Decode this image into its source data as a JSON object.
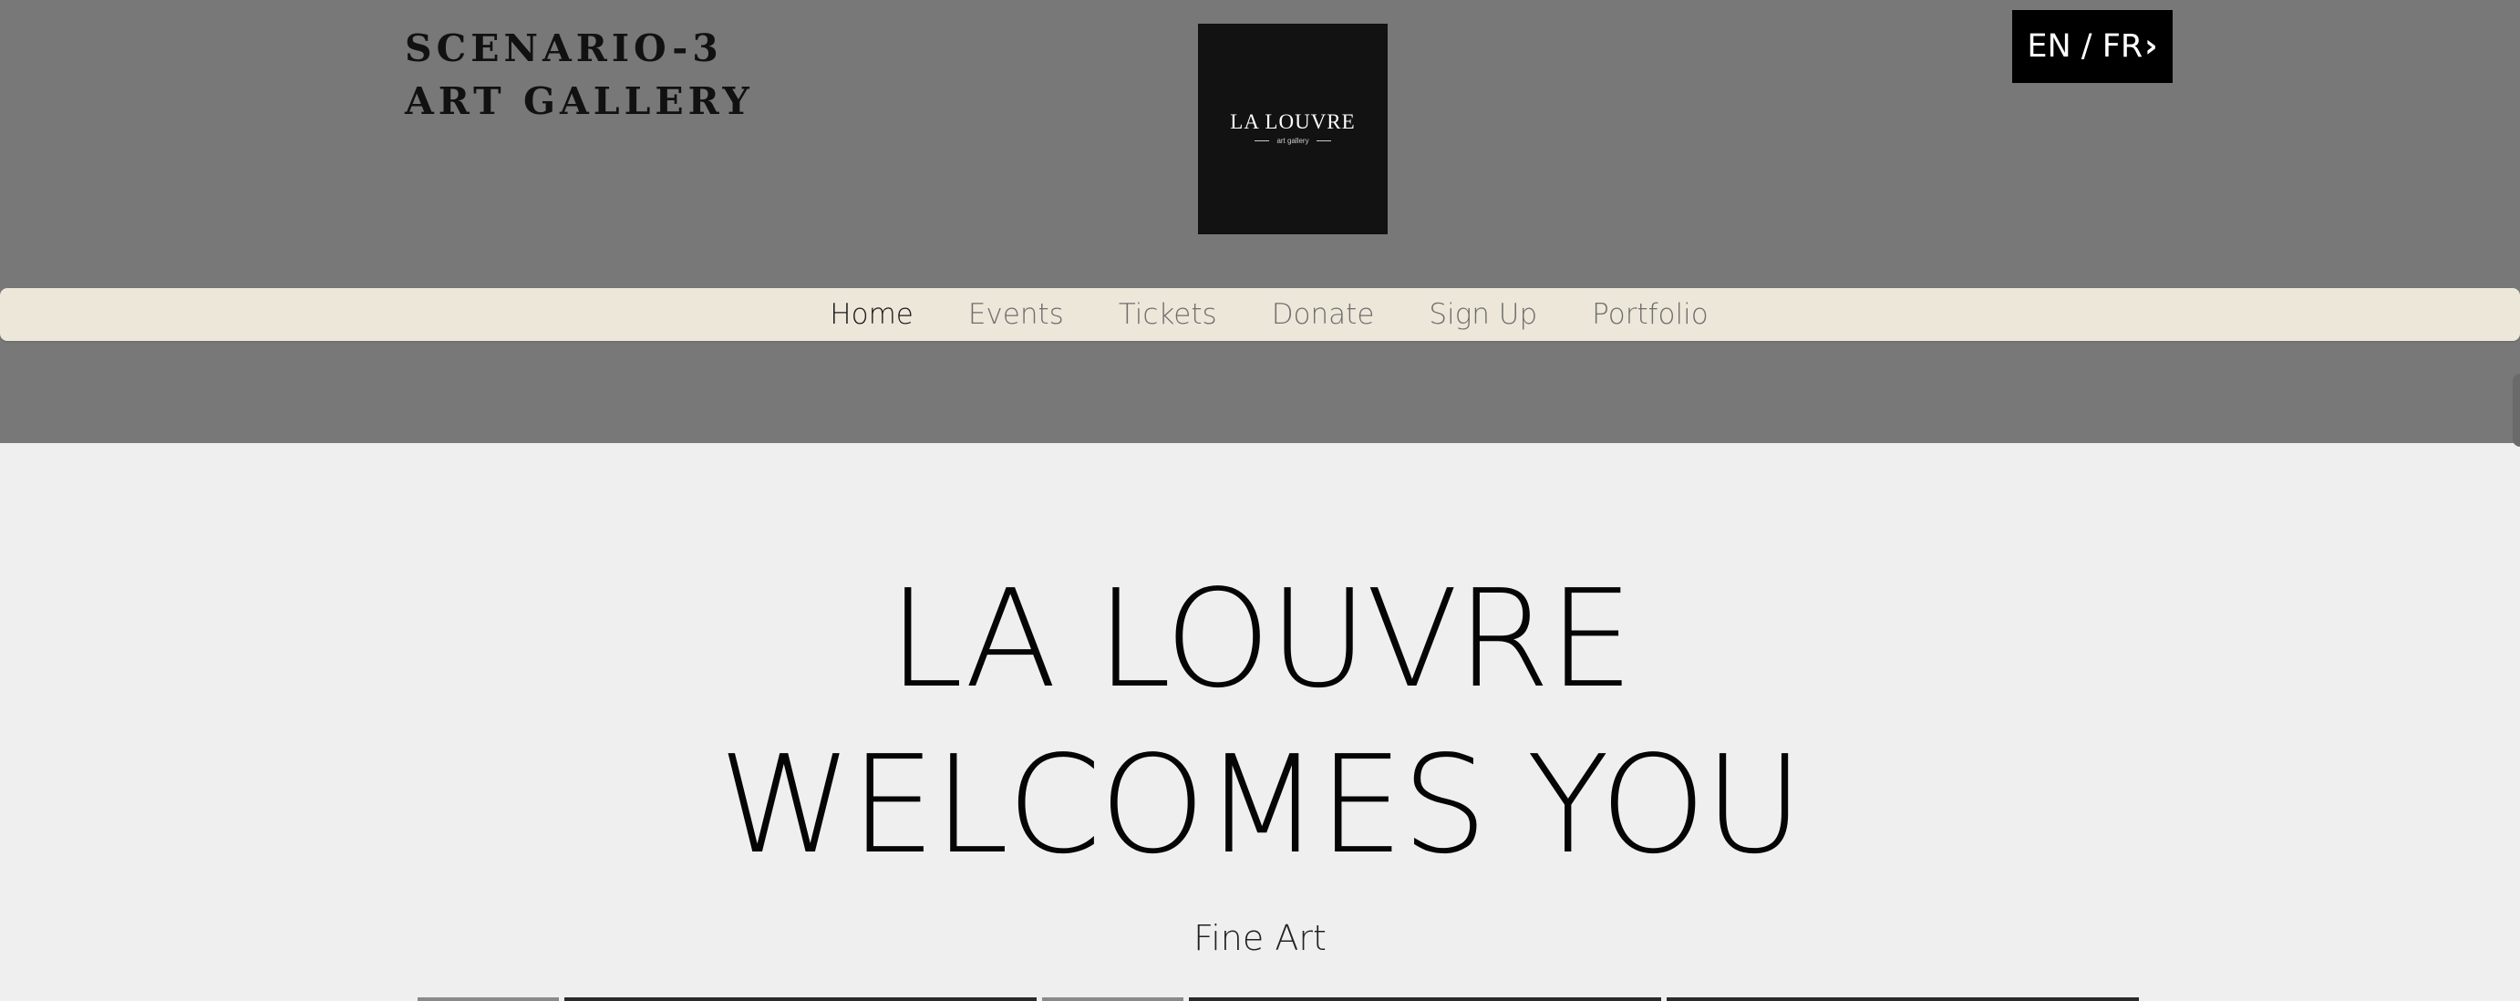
{
  "header": {
    "site_title_line1": "SCENARIO-3",
    "site_title_line2": "ART GALLERY",
    "background_color": "#787878"
  },
  "logo": {
    "name": "LA LOUVRE",
    "tagline": "art gallery",
    "background_color": "#121212"
  },
  "language_switch": {
    "label": "EN / FR",
    "chevron": "›"
  },
  "nav": {
    "background_color": "#ede7da",
    "items": [
      {
        "label": "Home",
        "active": true
      },
      {
        "label": "Events",
        "active": false
      },
      {
        "label": "Tickets",
        "active": false
      },
      {
        "label": "Donate",
        "active": false
      },
      {
        "label": "Sign Up",
        "active": false
      },
      {
        "label": "Portfolio",
        "active": false
      }
    ]
  },
  "hero": {
    "title_line1": "LA LOUVRE",
    "title_line2": "WELCOMES YOU",
    "subtitle": "Fine Art"
  }
}
